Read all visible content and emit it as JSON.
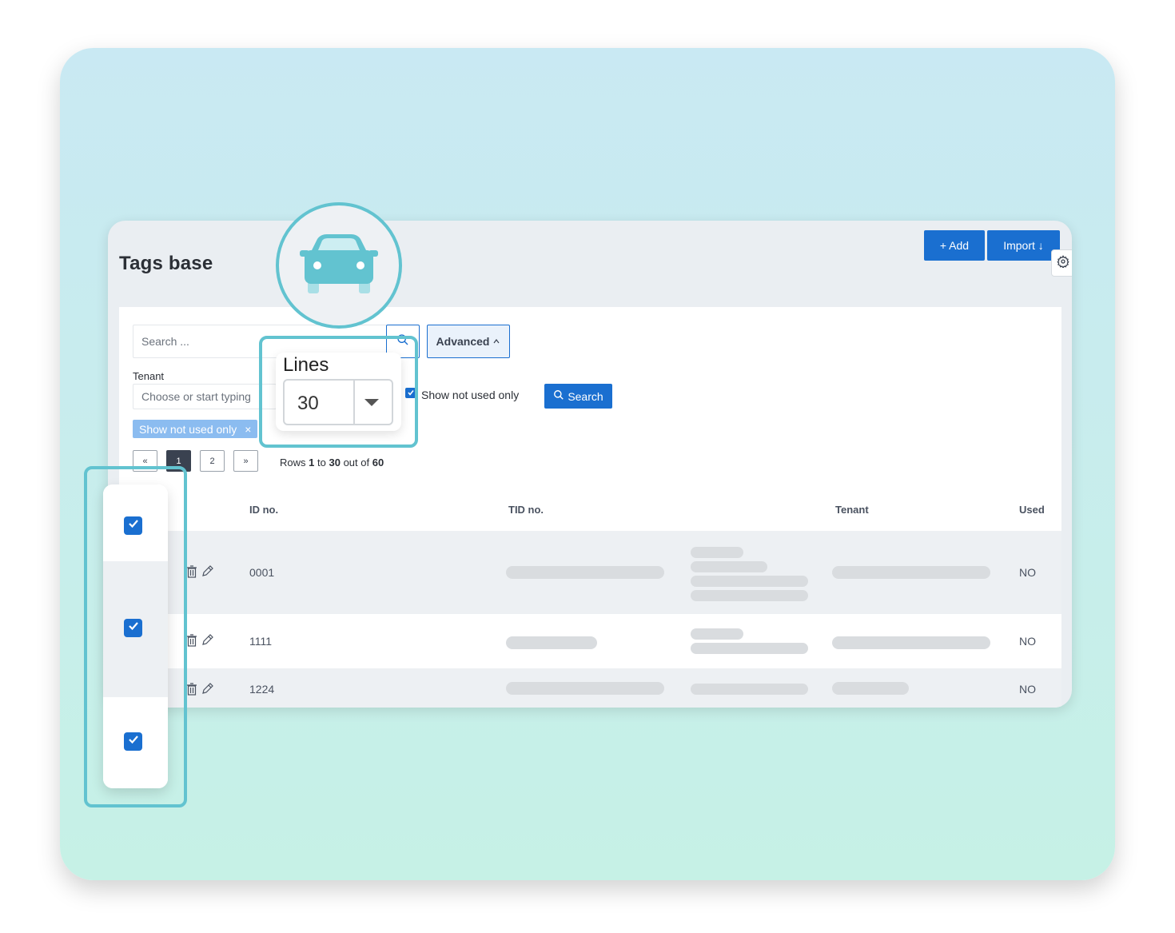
{
  "header": {
    "title": "Tags base",
    "add_label": "+ Add",
    "import_label": "Import ↓"
  },
  "search": {
    "placeholder": "Search ...",
    "advanced_label": "Advanced"
  },
  "filters": {
    "tenant_label": "Tenant",
    "tenant_placeholder": "Choose or start typing",
    "show_not_used_label": "Show not used only",
    "show_not_used_checked": true,
    "search_button_label": "Search",
    "active_chip_label": "Show not used only",
    "chip_close": "×"
  },
  "lines": {
    "title": "Lines",
    "value": "30"
  },
  "pagination": {
    "prev": "«",
    "pages": [
      "1",
      "2"
    ],
    "active_page": "1",
    "next": "»",
    "rows_prefix": "Rows",
    "rows_from": "1",
    "rows_to_word": "to",
    "rows_to": "30",
    "rows_outof_word": "out of",
    "rows_total": "60"
  },
  "table": {
    "columns": [
      "ID no.",
      "TID no.",
      "Tenant",
      "Used"
    ],
    "rows": [
      {
        "id": "0001",
        "used": "NO",
        "checked": true
      },
      {
        "id": "1111",
        "used": "NO",
        "checked": true
      },
      {
        "id": "1224",
        "used": "NO",
        "checked": true
      }
    ]
  },
  "colors": {
    "primary": "#1a6fd0",
    "accent_teal": "#62c3d0",
    "chip": "#8bbcf0"
  },
  "icons": [
    "car-icon",
    "search-icon",
    "gear-icon",
    "chevron-up-icon",
    "trash-icon",
    "pencil-icon",
    "checkmark-icon",
    "caret-down-icon"
  ]
}
